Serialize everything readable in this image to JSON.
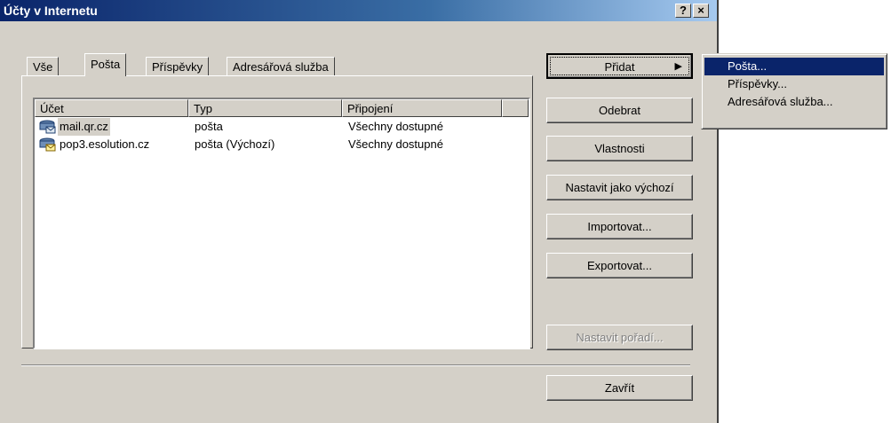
{
  "window": {
    "title": "Účty v Internetu",
    "help_btn": "?",
    "close_btn": "×"
  },
  "tabs": [
    {
      "label": "Vše",
      "active": false
    },
    {
      "label": "Pošta",
      "active": true
    },
    {
      "label": "Příspěvky",
      "active": false
    },
    {
      "label": "Adresářová služba",
      "active": false
    }
  ],
  "list": {
    "columns": [
      "Účet",
      "Typ",
      "Připojení"
    ],
    "rows": [
      {
        "account": "mail.qr.cz",
        "type": "pošta",
        "connection": "Všechny dostupné",
        "icon": "mail-server-icon"
      },
      {
        "account": "pop3.esolution.cz",
        "type": "pošta (Výchozí)",
        "connection": "Všechny dostupné",
        "icon": "mail-default-icon"
      }
    ]
  },
  "buttons": {
    "add": "Přidat",
    "remove": "Odebrat",
    "properties": "Vlastnosti",
    "set_default": "Nastavit jako výchozí",
    "import": "Importovat...",
    "export": "Exportovat...",
    "set_order": "Nastavit pořadí...",
    "close": "Zavřít"
  },
  "add_menu": {
    "items": [
      "Pošta...",
      "Příspěvky...",
      "Adresářová služba..."
    ],
    "highlighted_index": 0
  },
  "colors": {
    "face": "#d4d0c8",
    "title_start": "#0a246a",
    "title_end": "#a6caf0",
    "highlight": "#0a246a"
  }
}
